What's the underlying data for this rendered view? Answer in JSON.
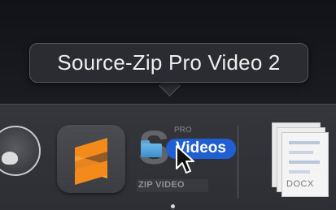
{
  "tooltip": {
    "text": "Source-Zip Pro Video 2"
  },
  "dock": {
    "apps": [
      {
        "name": "Round app (partially visible)",
        "icon": "round-app-icon"
      },
      {
        "name": "Sublime Text",
        "icon": "sublime-text-icon"
      },
      {
        "name": "Source-Zip Pro Video 2",
        "icon": "source-zip-icon",
        "caption": "ZIP VIDEO",
        "letter": "S",
        "small_text": "PRO"
      },
      {
        "name": "Document",
        "icon": "docx-document-icon",
        "caption": "DOCX"
      }
    ],
    "drag_item": {
      "label": "Videos",
      "icon": "folder-icon"
    }
  },
  "colors": {
    "drag_label_bg": "#1f5fd1",
    "sublime_orange": "#f48a1a",
    "folder_blue": "#4a9ad6"
  }
}
